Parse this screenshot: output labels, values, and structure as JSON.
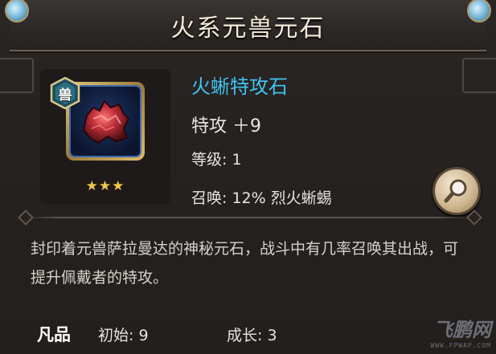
{
  "header": {
    "title": "火系元兽元石"
  },
  "item": {
    "name": "火蜥特攻石",
    "badge": "兽",
    "stars": "★★★",
    "attack_line": "特攻 ＋9",
    "level_line": "等级: 1",
    "summon_line": "召唤: 12% 烈火蜥蜴"
  },
  "description": "封印着元兽萨拉曼达的神秘元石，战斗中有几率召唤其出战，可提升佩戴者的特攻。",
  "footer": {
    "quality": "凡品",
    "initial": "初始: 9",
    "growth": "成长: 3"
  },
  "watermark": {
    "logo": "飞鹏网",
    "url": "WWW.FPWAP.COM"
  },
  "colors": {
    "item_name": "#3fc3f0",
    "stars": "#f2c84b",
    "frame_gold": "#d6b46a"
  },
  "icons": {
    "badge": "beast-badge-icon",
    "item": "fire-lizard-stone-icon",
    "magnify": "magnifier-icon"
  }
}
